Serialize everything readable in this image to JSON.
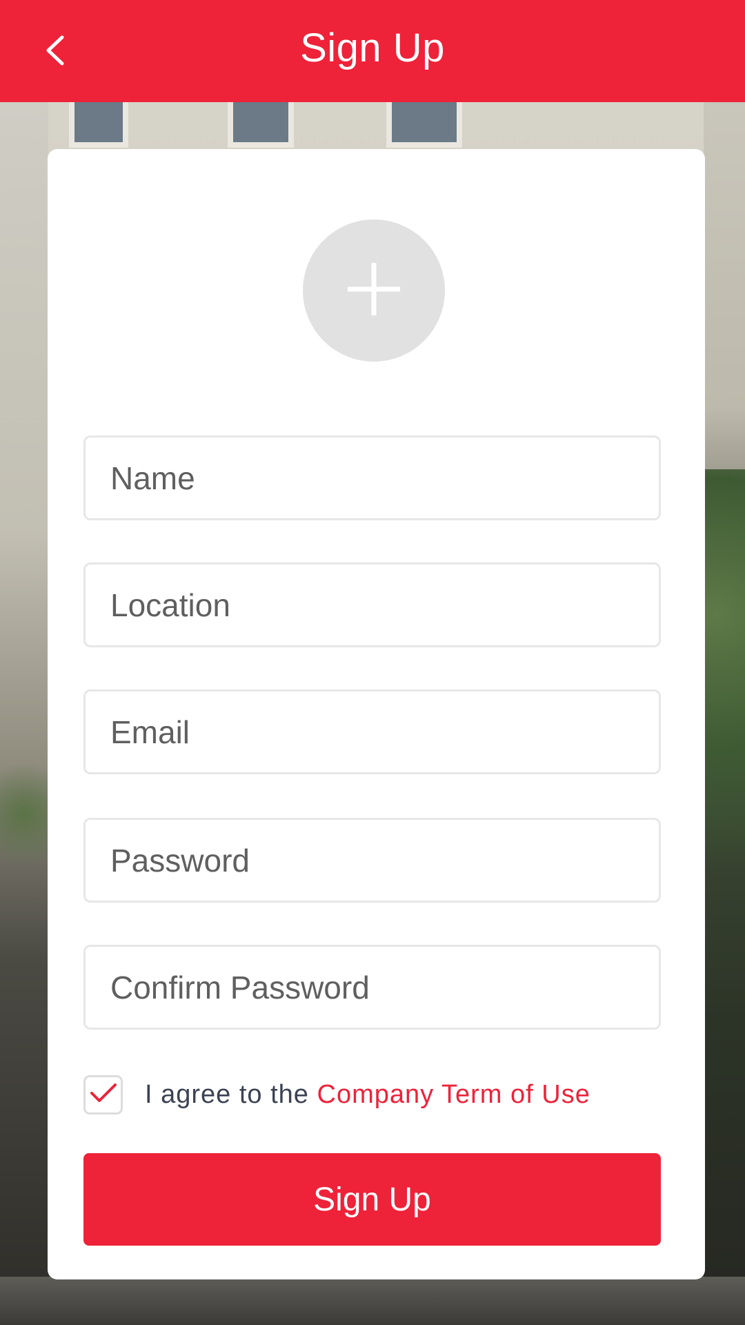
{
  "header": {
    "title": "Sign Up",
    "back_icon": "chevron-left-icon"
  },
  "avatar": {
    "icon": "plus-icon"
  },
  "form": {
    "fields": [
      {
        "placeholder": "Name",
        "value": ""
      },
      {
        "placeholder": "Location",
        "value": ""
      },
      {
        "placeholder": "Email",
        "value": ""
      },
      {
        "placeholder": "Password",
        "value": ""
      },
      {
        "placeholder": "Confirm Password",
        "value": ""
      }
    ],
    "agree": {
      "checked": true,
      "prefix": "I agree to the ",
      "link_text": "Company Term of Use"
    },
    "submit_label": "Sign Up"
  },
  "colors": {
    "accent": "#ee2239",
    "field_border": "#e7e7e7",
    "avatar_bg": "#e1e1e1"
  }
}
